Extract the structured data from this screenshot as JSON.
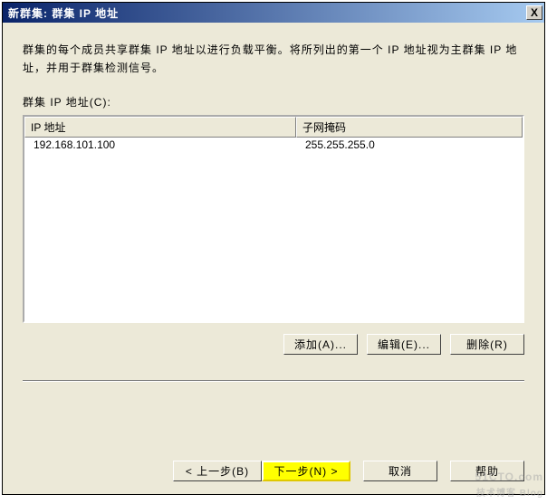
{
  "titlebar": {
    "title": "新群集:   群集 IP 地址",
    "close": "X"
  },
  "content": {
    "description": "群集的每个成员共享群集 IP 地址以进行负载平衡。将所列出的第一个 IP 地址视为主群集 IP 地址，并用于群集检测信号。",
    "list_label": "群集 IP 地址(C):"
  },
  "table": {
    "headers": {
      "ip": "IP 地址",
      "mask": "子网掩码"
    },
    "rows": [
      {
        "ip": "192.168.101.100",
        "mask": "255.255.255.0"
      }
    ]
  },
  "buttons": {
    "add": "添加(A)...",
    "edit": "编辑(E)...",
    "remove": "删除(R)"
  },
  "nav": {
    "back": "< 上一步(B)",
    "next": "下一步(N) >",
    "cancel": "取消",
    "help": "帮助"
  },
  "watermark": {
    "main": "51CTO.com",
    "sub": "技术博客 Blog"
  }
}
